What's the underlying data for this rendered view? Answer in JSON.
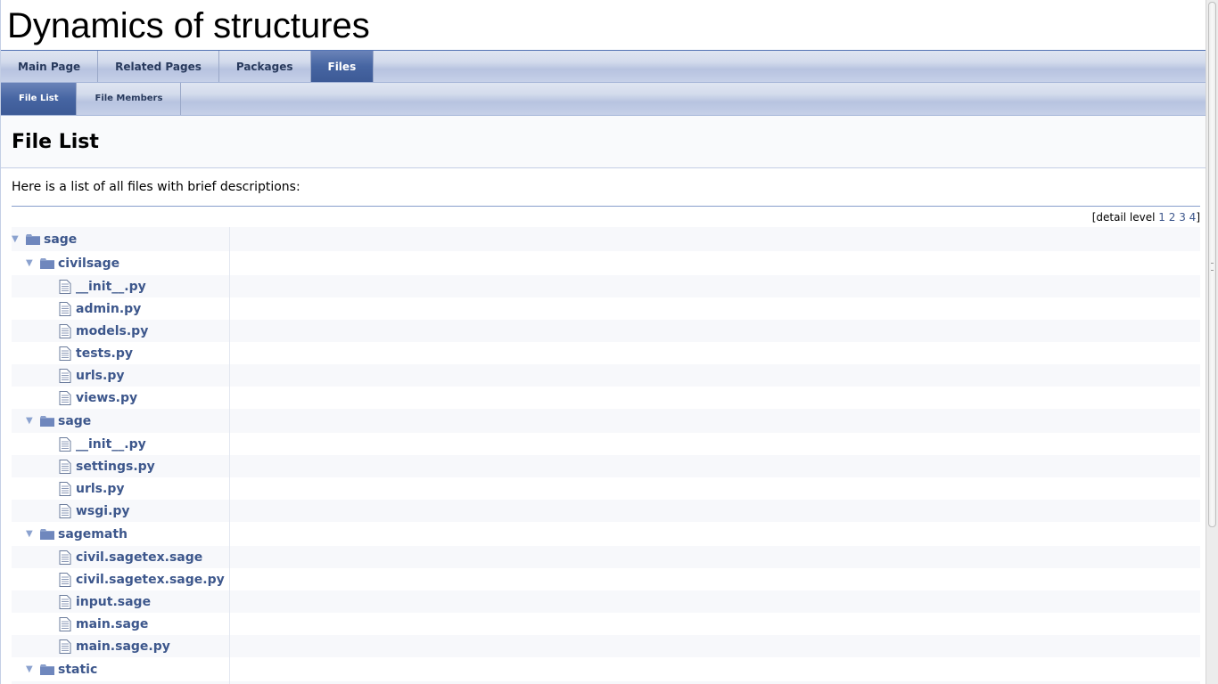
{
  "project": {
    "name": "Dynamics of structures"
  },
  "main_tabs": [
    {
      "label": "Main Page",
      "active": false
    },
    {
      "label": "Related Pages",
      "active": false
    },
    {
      "label": "Packages",
      "active": false
    },
    {
      "label": "Files",
      "active": true
    }
  ],
  "sub_tabs": [
    {
      "label": "File List",
      "active": true
    },
    {
      "label": "File Members",
      "active": false
    }
  ],
  "header": {
    "title": "File List"
  },
  "intro": "Here is a list of all files with brief descriptions:",
  "detail_level": {
    "label_open": "[detail level ",
    "levels": [
      "1",
      "2",
      "3",
      "4"
    ],
    "label_close": "]"
  },
  "tree": [
    {
      "type": "dir",
      "level": 0,
      "name": "sage",
      "arrow": "▼"
    },
    {
      "type": "dir",
      "level": 1,
      "name": "civilsage",
      "arrow": "▼"
    },
    {
      "type": "file",
      "level": 2,
      "name": "__init__.py"
    },
    {
      "type": "file",
      "level": 2,
      "name": "admin.py"
    },
    {
      "type": "file",
      "level": 2,
      "name": "models.py"
    },
    {
      "type": "file",
      "level": 2,
      "name": "tests.py"
    },
    {
      "type": "file",
      "level": 2,
      "name": "urls.py"
    },
    {
      "type": "file",
      "level": 2,
      "name": "views.py"
    },
    {
      "type": "dir",
      "level": 1,
      "name": "sage",
      "arrow": "▼"
    },
    {
      "type": "file",
      "level": 2,
      "name": "__init__.py"
    },
    {
      "type": "file",
      "level": 2,
      "name": "settings.py"
    },
    {
      "type": "file",
      "level": 2,
      "name": "urls.py"
    },
    {
      "type": "file",
      "level": 2,
      "name": "wsgi.py"
    },
    {
      "type": "dir",
      "level": 1,
      "name": "sagemath",
      "arrow": "▼"
    },
    {
      "type": "file",
      "level": 2,
      "name": "civil.sagetex.sage"
    },
    {
      "type": "file",
      "level": 2,
      "name": "civil.sagetex.sage.py"
    },
    {
      "type": "file",
      "level": 2,
      "name": "input.sage"
    },
    {
      "type": "file",
      "level": 2,
      "name": "main.sage"
    },
    {
      "type": "file",
      "level": 2,
      "name": "main.sage.py"
    },
    {
      "type": "dir",
      "level": 1,
      "name": "static",
      "arrow": "▼"
    },
    {
      "type": "file",
      "level": 2,
      "name": ""
    }
  ],
  "colors": {
    "link": "#3d578c",
    "active_tab": "#4665a2",
    "row_alt": "#f7f8fb"
  }
}
